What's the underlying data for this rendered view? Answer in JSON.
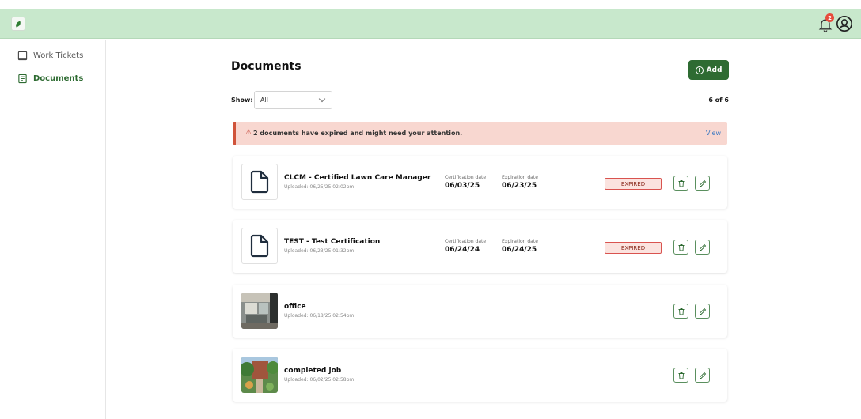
{
  "header": {
    "notification_count": "2"
  },
  "sidebar": {
    "items": [
      {
        "label": "Work Tickets"
      },
      {
        "label": "Documents"
      }
    ]
  },
  "main": {
    "title": "Documents",
    "add_label": "Add",
    "show_label": "Show:",
    "show_value": "All",
    "count": "6 of 6",
    "alert": {
      "icon": "⚠",
      "text": "2 documents have expired and might need your attention.",
      "link": "View"
    }
  },
  "documents": [
    {
      "name": "CLCM - Certified Lawn Care Manager",
      "uploaded": "Uploaded: 06/25/25 02:02pm",
      "cert_label": "Certification date",
      "cert_date": "06/03/25",
      "exp_label": "Expiration date",
      "exp_date": "06/23/25",
      "status": "EXPIRED"
    },
    {
      "name": "TEST - Test Certification",
      "uploaded": "Uploaded: 06/23/25 01:32pm",
      "cert_label": "Certification date",
      "cert_date": "06/24/24",
      "exp_label": "Expiration date",
      "exp_date": "06/24/25",
      "status": "EXPIRED"
    },
    {
      "name": "office",
      "uploaded": "Uploaded: 06/18/25 02:54pm"
    },
    {
      "name": "completed job",
      "uploaded": "Uploaded: 06/02/25 02:58pm"
    }
  ],
  "colors": {
    "header_bg": "#c8e8cc",
    "accent": "#2e6b32",
    "alert_bg": "#f8d7d0",
    "expired": "#d9534f"
  },
  "icons": [
    "logo-icon",
    "bell-icon",
    "user-icon",
    "ticket-icon",
    "documents-icon",
    "file-icon",
    "trash-icon",
    "edit-icon",
    "warning-icon",
    "plus-circle-icon",
    "chevron-down-icon"
  ]
}
